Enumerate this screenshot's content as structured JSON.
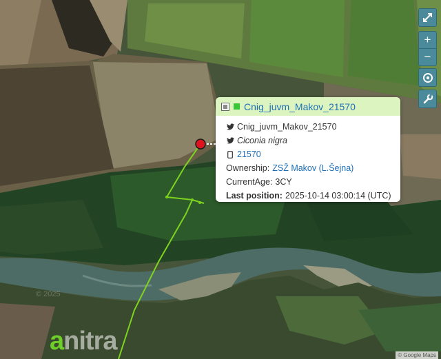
{
  "map": {
    "controls": {
      "fullscreen": "fullscreen-icon",
      "zoom_in": "+",
      "zoom_out": "−",
      "locate": "target-icon",
      "tools": "wrench-icon"
    },
    "attribution": "© Google Maps",
    "watermark": "© 2025",
    "logo": {
      "first": "a",
      "rest": "nitra"
    }
  },
  "popup": {
    "title": "Cnig_juvm_Makov_21570",
    "twitter_name": "Cnig_juvm_Makov_21570",
    "species": "Ciconia nigra",
    "device_id": "21570",
    "ownership_label": "Ownership:",
    "ownership_value": "ZSŽ Makov (L.Šejna)",
    "age_label": "CurrentAge:",
    "age_value": "3CY",
    "last_position_label": "Last position:",
    "last_position_value": "2025-10-14 03:00:14 (UTC)"
  },
  "colors": {
    "track": "#7ed321",
    "marker": "#e0141e",
    "popup_header": "#dcf5c0",
    "link": "#1f6fb7",
    "control": "#4a8a9a"
  }
}
